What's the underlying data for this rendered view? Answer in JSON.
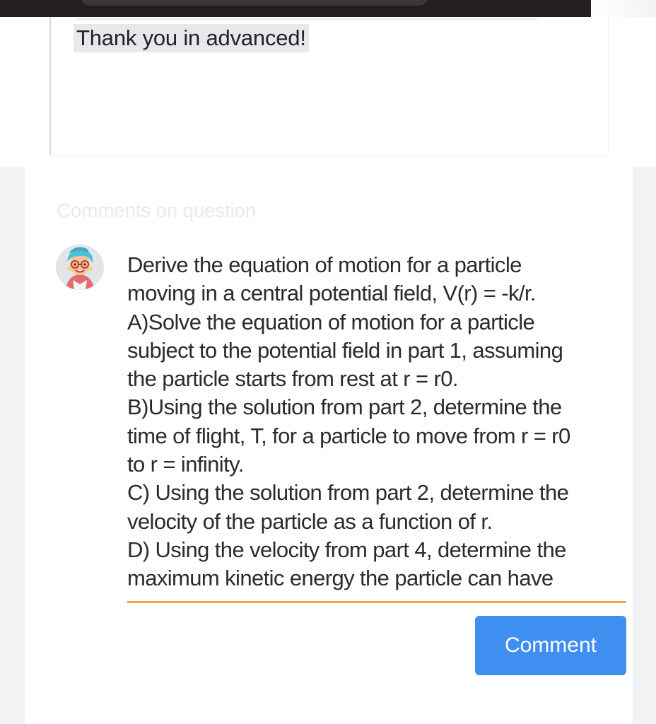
{
  "post": {
    "text": "Thank you in advanced!"
  },
  "comments_section": {
    "heading": "Comments on question"
  },
  "comment_input": {
    "value": "Derive the equation of motion for a particle\nmoving in a central potential field, V(r) = -k/r.\nA)Solve the equation of motion for a particle\nsubject to the potential field in part 1, assuming\nthe particle starts from rest at r = r0.\nB)Using the solution from part 2, determine the\ntime of flight, T, for a particle to move from r = r0\nto r = infinity.\nC) Using the solution from part 2, determine the\nvelocity of the particle as a function of r.\nD) Using the velocity from part 4, determine the\nmaximum kinetic energy the particle can have"
  },
  "comment_button": {
    "label": "Comment"
  },
  "colors": {
    "accent_underline": "#f0a83f",
    "button": "#3f8ff1"
  },
  "icons": {
    "avatar": "user-avatar-icon"
  }
}
